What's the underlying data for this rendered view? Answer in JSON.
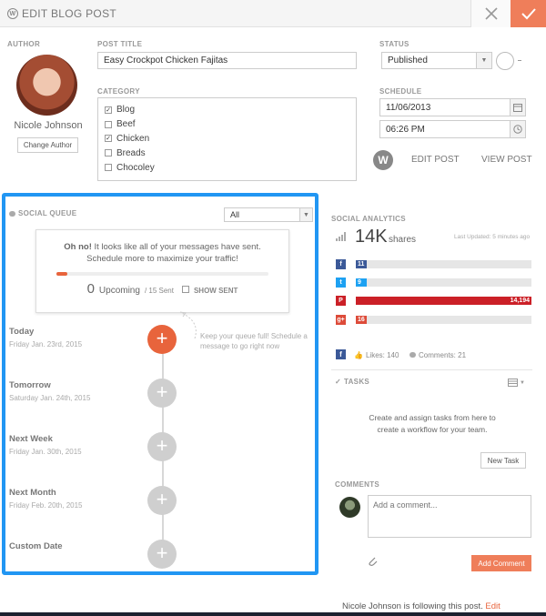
{
  "header": {
    "title": "EDIT BLOG POST"
  },
  "author": {
    "label": "AUTHOR",
    "name": "Nicole Johnson",
    "change_label": "Change Author"
  },
  "post": {
    "title_label": "POST TITLE",
    "title_value": "Easy Crockpot Chicken Fajitas"
  },
  "category": {
    "label": "CATEGORY",
    "items": [
      {
        "label": "Blog",
        "checked": true
      },
      {
        "label": "Beef",
        "checked": false
      },
      {
        "label": "Chicken",
        "checked": true
      },
      {
        "label": "Breads",
        "checked": false
      },
      {
        "label": "Chocoley",
        "checked": false
      }
    ]
  },
  "status": {
    "label": "STATUS",
    "value": "Published"
  },
  "schedule": {
    "label": "SCHEDULE",
    "date": "11/06/2013",
    "time": "06:26 PM"
  },
  "post_links": {
    "edit": "EDIT POST",
    "view": "VIEW POST"
  },
  "social_queue": {
    "label": "SOCIAL QUEUE",
    "filter": "All",
    "message_bold": "Oh no!",
    "message_rest": " It looks like all of your messages have sent. Schedule more to maximize your traffic!",
    "progress_fraction": 0.05,
    "upcoming_count": "0",
    "upcoming_label": "Upcoming",
    "sent_label": "/ 15 Sent",
    "show_sent": "SHOW SENT",
    "hint": "Keep your queue full! Schedule a message to go right now",
    "slots": [
      {
        "title": "Today",
        "date": "Friday Jan. 23rd, 2015"
      },
      {
        "title": "Tomorrow",
        "date": "Saturday Jan. 24th, 2015"
      },
      {
        "title": "Next Week",
        "date": "Friday Jan. 30th, 2015"
      },
      {
        "title": "Next Month",
        "date": "Friday Feb. 20th, 2015"
      },
      {
        "title": "Custom Date",
        "date": ""
      }
    ]
  },
  "analytics": {
    "label": "SOCIAL ANALYTICS",
    "shares_value": "14K",
    "shares_label": "shares",
    "updated": "Last Updated: 5 minutes ago",
    "networks": [
      {
        "name": "facebook",
        "glyph": "f",
        "color": "#3b5998",
        "value": "11",
        "fraction": 0.06
      },
      {
        "name": "twitter",
        "glyph": "t",
        "color": "#1da1f2",
        "value": "9",
        "fraction": 0.06
      },
      {
        "name": "pinterest",
        "glyph": "P",
        "color": "#cb2027",
        "value": "14,194",
        "fraction": 1.0
      },
      {
        "name": "google-plus",
        "glyph": "g+",
        "color": "#dd4b39",
        "value": "16",
        "fraction": 0.06
      }
    ],
    "likes": "Likes: 140",
    "comments": "Comments: 21"
  },
  "tasks": {
    "label": "TASKS",
    "empty_text": "Create and assign tasks from here to create a workflow for your team.",
    "new_task": "New Task"
  },
  "comments": {
    "label": "COMMENTS",
    "placeholder": "Add a comment...",
    "add_button": "Add Comment"
  },
  "footer": {
    "following_text": "Nicole Johnson is following this post.",
    "edit_link": "Edit"
  },
  "colors": {
    "accent": "#ef7e5a",
    "highlight": "#2196f3"
  }
}
